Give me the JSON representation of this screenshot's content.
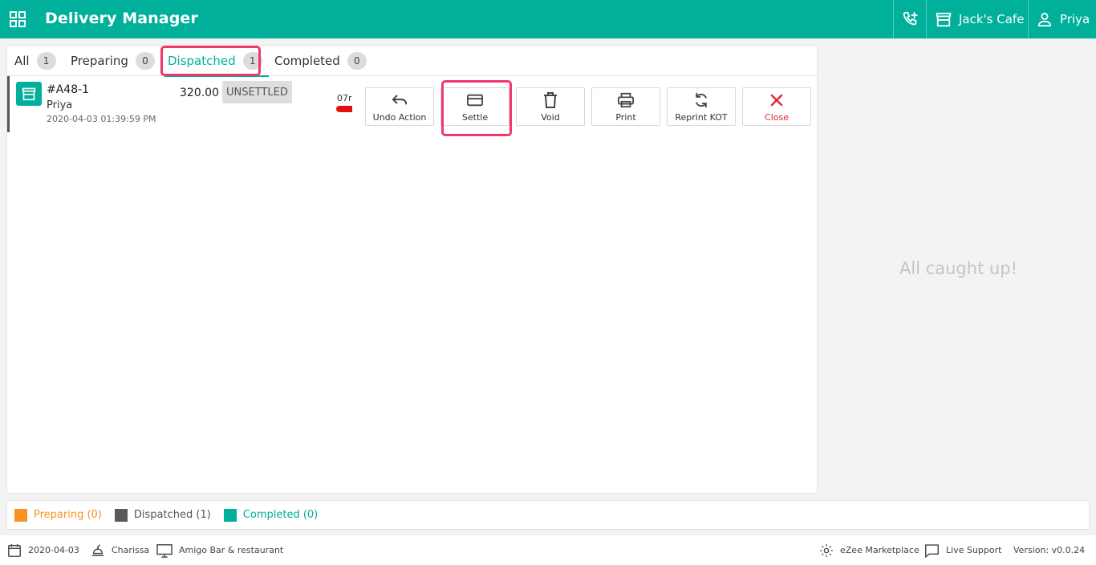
{
  "header": {
    "title": "Delivery Manager",
    "cafe": "Jack's Cafe",
    "user": "Priya",
    "bg_color": "#00b09b"
  },
  "tabs": [
    {
      "label": "All",
      "count": "1"
    },
    {
      "label": "Preparing",
      "count": "0"
    },
    {
      "label": "Dispatched",
      "count": "1"
    },
    {
      "label": "Completed",
      "count": "0"
    }
  ],
  "active_tab": "Dispatched",
  "order": {
    "id": "#A48-1",
    "customer": "Priya",
    "datetime": "2020-04-03 01:39:59 PM",
    "amount": "320.00",
    "status": "UNSETTLED",
    "timer": "07r"
  },
  "actions": [
    {
      "label": "Undo Action",
      "icon": "undo-icon"
    },
    {
      "label": "Settle",
      "icon": "card-icon"
    },
    {
      "label": "Void",
      "icon": "trash-icon"
    },
    {
      "label": "Print",
      "icon": "printer-icon"
    },
    {
      "label": "Reprint KOT",
      "icon": "refresh-icon"
    },
    {
      "label": "Close",
      "icon": "close-icon"
    }
  ],
  "side_message": "All caught up!",
  "legend": [
    {
      "label": "Preparing (0)",
      "color": "#f7931e"
    },
    {
      "label": "Dispatched (1)",
      "color": "#5a5a5a"
    },
    {
      "label": "Completed (0)",
      "color": "#00b09b"
    }
  ],
  "footer": {
    "date": "2020-04-03",
    "waiter": "Charissa",
    "terminal": "Amigo Bar & restaurant",
    "marketplace": "eZee Marketplace",
    "support": "Live Support",
    "version": "Version: v0.0.24"
  }
}
